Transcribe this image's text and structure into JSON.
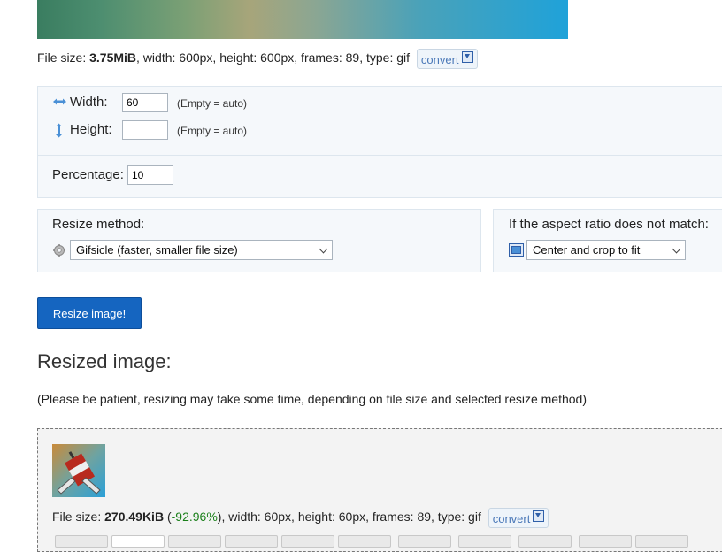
{
  "source": {
    "label_prefix": "File size:",
    "size": "3.75MiB",
    "details": ", width: 600px, height: 600px, frames: 89, type: gif",
    "convert_label": "convert"
  },
  "dimensions": {
    "width_label": "Width:",
    "width_value": "60",
    "width_hint": "(Empty = auto)",
    "height_label": "Height:",
    "height_value": "",
    "height_hint": "(Empty = auto)",
    "percentage_label": "Percentage:",
    "percentage_value": "10"
  },
  "resize_method": {
    "label": "Resize method:",
    "selected": "Gifsicle (faster, smaller file size)",
    "icon": "gear-icon"
  },
  "aspect": {
    "label": "If the aspect ratio does not match:",
    "selected": "Center and crop to fit",
    "icon": "crop-icon"
  },
  "resize_button": "Resize image!",
  "result": {
    "heading": "Resized image:",
    "note": "(Please be patient, resizing may take some time, depending on file size and selected resize method)",
    "label_prefix": "File size:",
    "size": "270.49KiB",
    "pct_open": " (",
    "pct": "-92.96%",
    "details": "), width: 60px, height: 60px, frames: 89, type: gif",
    "convert_label": "convert"
  },
  "colors": {
    "button": "#1565c0",
    "panel": "#f5f8fb",
    "savings": "#1a7f1a"
  }
}
